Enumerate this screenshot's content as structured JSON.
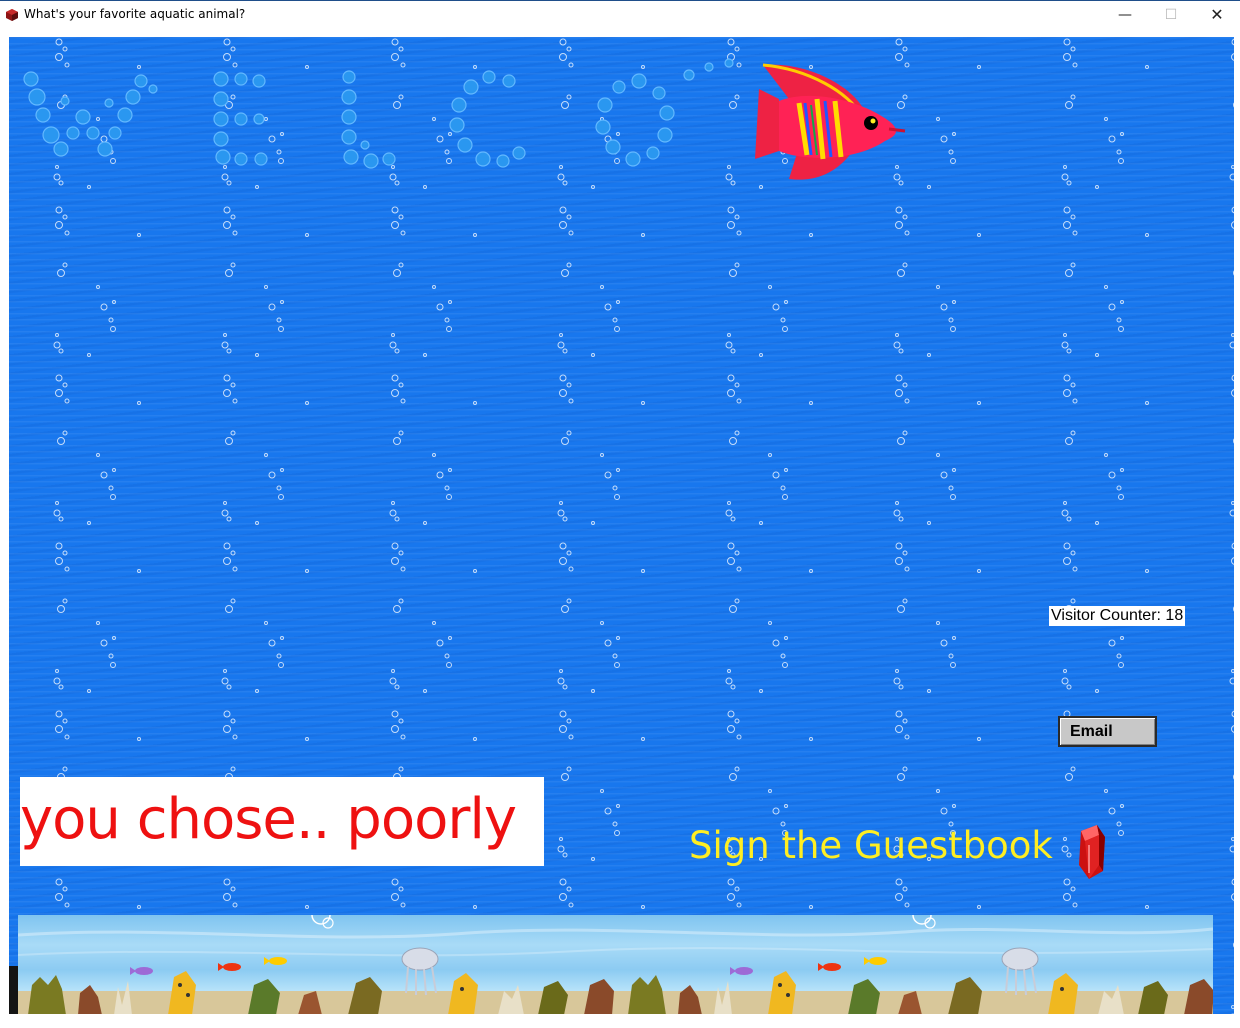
{
  "window": {
    "title": "What's your favorite aquatic animal?",
    "minimize_glyph": "—",
    "maximize_glyph": "☐",
    "close_glyph": "✕"
  },
  "page": {
    "visitor_counter": "Visitor Counter: 18",
    "email_button": "Email",
    "result_message": "you chose.. poorly",
    "guestbook_link": "Sign the Guestbook"
  },
  "colors": {
    "background": "#1877ee",
    "result_text": "#ee1111",
    "guestbook_text": "#ffee22"
  },
  "icons": [
    "app-icon",
    "bubble-letters-welcome",
    "angelfish-icon",
    "red-book-icon",
    "aquarium-scene"
  ]
}
